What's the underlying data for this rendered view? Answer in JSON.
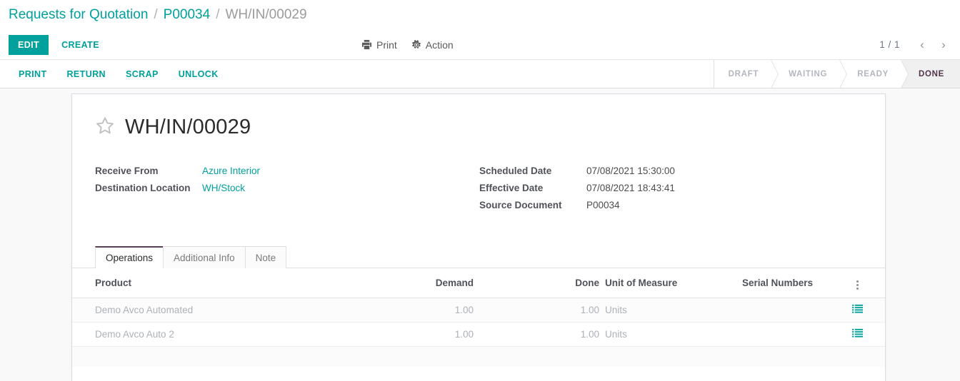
{
  "breadcrumb": {
    "items": [
      {
        "label": "Requests for Quotation",
        "type": "link"
      },
      {
        "label": "P00034",
        "type": "link"
      },
      {
        "label": "WH/IN/00029",
        "type": "current"
      }
    ],
    "separator": "/"
  },
  "control_panel": {
    "edit_label": "EDIT",
    "create_label": "CREATE",
    "print_label": "Print",
    "action_label": "Action",
    "print_icon": "printer-icon",
    "action_icon": "gear-icon",
    "pager": {
      "count": "1 / 1",
      "previous_icon": "chevron-left-icon",
      "next_icon": "chevron-right-icon"
    }
  },
  "statusbar": {
    "buttons": [
      {
        "label": "PRINT"
      },
      {
        "label": "RETURN"
      },
      {
        "label": "SCRAP"
      },
      {
        "label": "UNLOCK"
      }
    ],
    "states": [
      {
        "label": "DRAFT",
        "active": false
      },
      {
        "label": "WAITING",
        "active": false
      },
      {
        "label": "READY",
        "active": false
      },
      {
        "label": "DONE",
        "active": true
      }
    ],
    "active_color": "#51344b"
  },
  "record": {
    "favorite_icon": "star-outline-icon",
    "title": "WH/IN/00029",
    "fields_left": [
      {
        "label": "Receive From",
        "value": "Azure Interior",
        "is_link": true
      },
      {
        "label": "Destination Location",
        "value": "WH/Stock",
        "is_link": true
      }
    ],
    "fields_right": [
      {
        "label": "Scheduled Date",
        "value": "07/08/2021 15:30:00",
        "is_link": false
      },
      {
        "label": "Effective Date",
        "value": "07/08/2021 18:43:41",
        "is_link": false
      },
      {
        "label": "Source Document",
        "value": "P00034",
        "is_link": false
      }
    ]
  },
  "notebook": {
    "tabs": [
      {
        "label": "Operations",
        "active": true
      },
      {
        "label": "Additional Info",
        "active": false
      },
      {
        "label": "Note",
        "active": false
      }
    ]
  },
  "lines_table": {
    "columns": {
      "product": "Product",
      "demand": "Demand",
      "done": "Done",
      "uom": "Unit of Measure",
      "serial": "Serial Numbers",
      "optional_toggle_icon": "vertical-dots-icon"
    },
    "rows": [
      {
        "product": "Demo Avco Automated",
        "demand": "1.00",
        "done": "1.00",
        "uom": "Units",
        "serial": "",
        "detail_icon": "list-lines-icon"
      },
      {
        "product": "Demo Avco Auto 2",
        "demand": "1.00",
        "done": "1.00",
        "uom": "Units",
        "serial": "",
        "detail_icon": "list-lines-icon"
      }
    ]
  },
  "theme": {
    "accent": "#00a09d",
    "page_bg": "#f9f9f9",
    "sheet_bg": "#ffffff",
    "muted_text": "#adb2b8"
  }
}
